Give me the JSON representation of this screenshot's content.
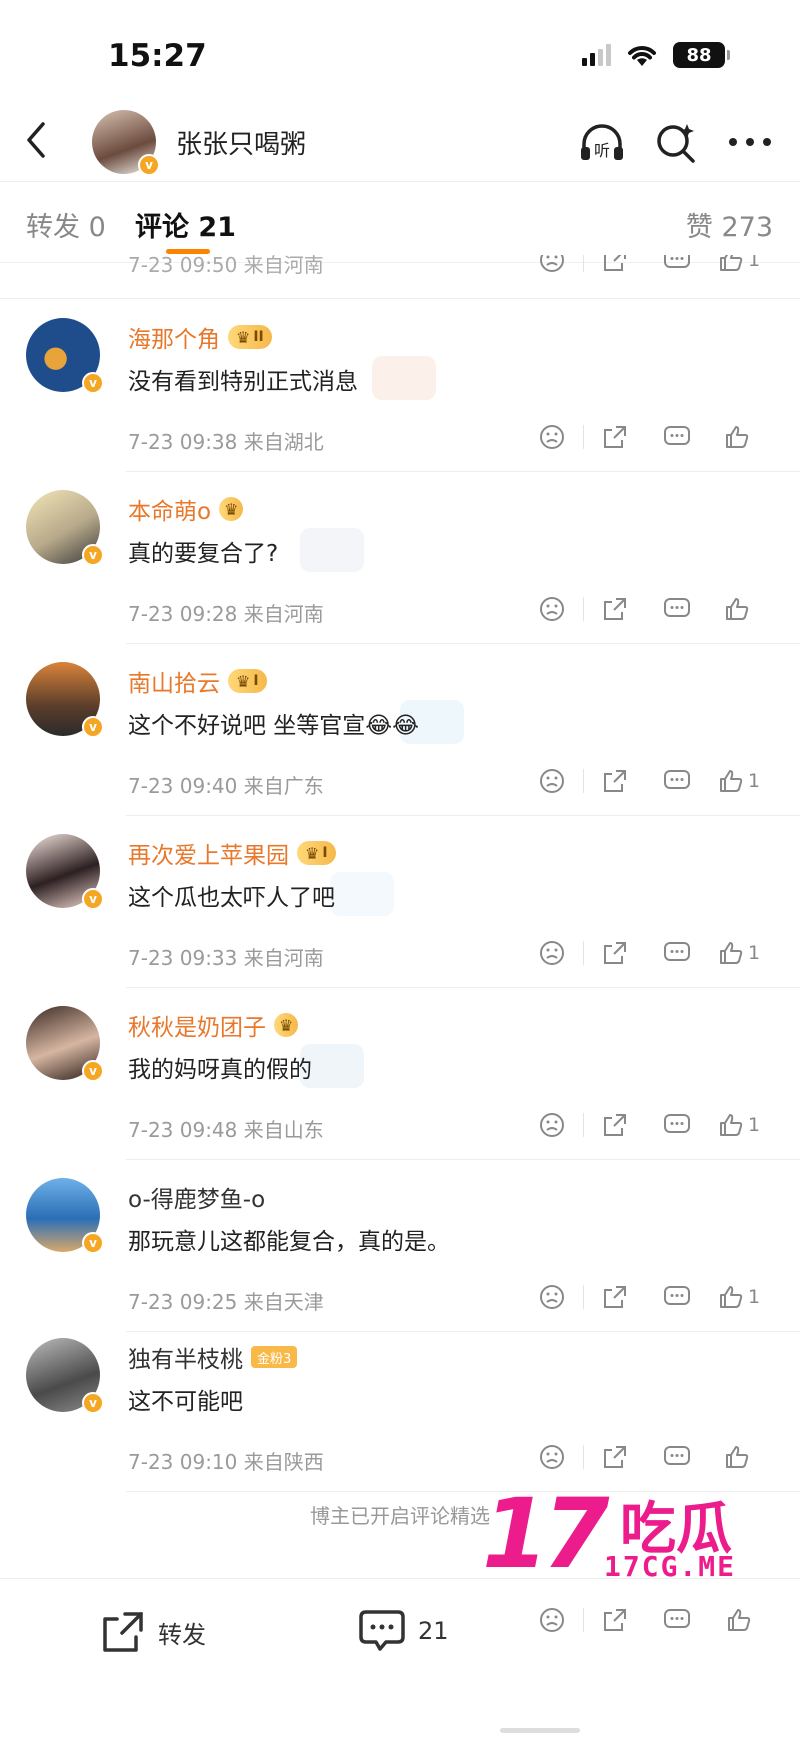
{
  "status": {
    "time": "15:27",
    "battery": "88"
  },
  "nav": {
    "title": "张张只喝粥",
    "listen_label": "听"
  },
  "tabs": {
    "repost": "转发 0",
    "comment": "评论 21",
    "like": "赞 273"
  },
  "partial": {
    "meta": "7-23 09:50 来自河南",
    "like_count": "1"
  },
  "comments": [
    {
      "name": "海那个角",
      "badge": "II",
      "text": "没有看到特别正式消息",
      "meta": "7-23 09:38 来自湖北",
      "like_count": ""
    },
    {
      "name": "本命萌o",
      "badge": "",
      "text": "真的要复合了?",
      "meta": "7-23 09:28 来自河南",
      "like_count": ""
    },
    {
      "name": "南山拾云",
      "badge": "I",
      "text": "这个不好说吧 坐等官宣😂😂",
      "meta": "7-23 09:40 来自广东",
      "like_count": "1"
    },
    {
      "name": "再次爱上苹果园",
      "badge": "I",
      "text": "这个瓜也太吓人了吧",
      "meta": "7-23 09:33 来自河南",
      "like_count": "1"
    },
    {
      "name": "秋秋是奶团子",
      "badge": "",
      "text": "我的妈呀真的假的",
      "meta": "7-23 09:48 来自山东",
      "like_count": "1"
    },
    {
      "name": "o-得鹿梦鱼-o",
      "badge": "",
      "text": "那玩意儿这都能复合，真的是。",
      "meta": "7-23 09:25 来自天津",
      "like_count": "1"
    },
    {
      "name": "独有半枝桃",
      "badge": "金粉3",
      "text": "这不可能吧",
      "meta": "7-23 09:10 来自陕西",
      "like_count": ""
    }
  ],
  "footer_note": "博主已开启评论精选",
  "bottom": {
    "repost_label": "转发",
    "comment_count": "21"
  },
  "watermark": {
    "big": "17",
    "cn": "吃瓜",
    "url": "17CG.ME"
  },
  "colors": {
    "accent": "#ff8200",
    "username": "#e8782b",
    "watermark": "#ec1c8c"
  }
}
